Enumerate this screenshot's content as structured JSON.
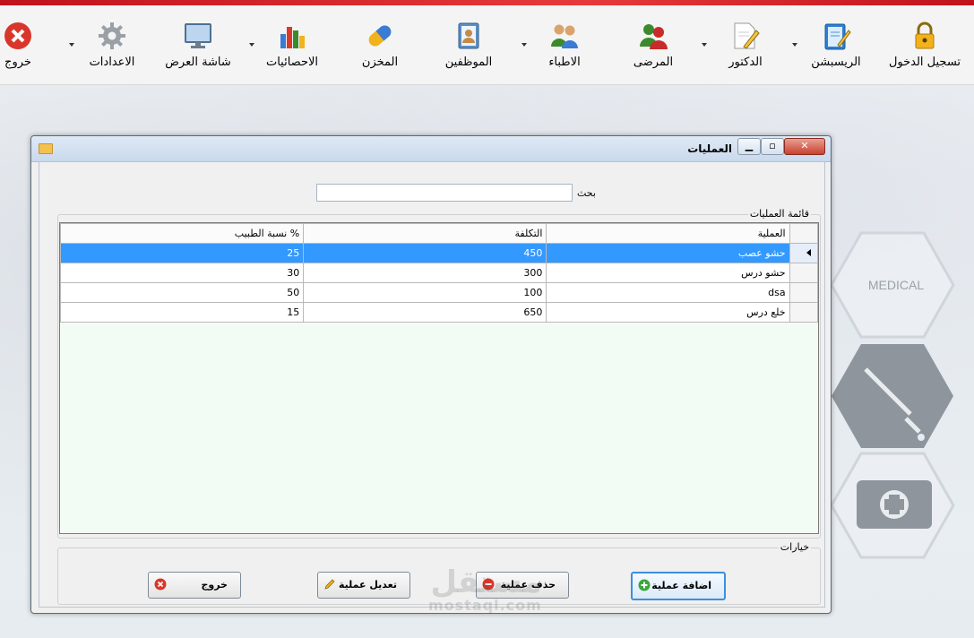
{
  "toolbar": {
    "items": [
      {
        "label": "تسجيل الدخول",
        "icon": "lock-icon"
      },
      {
        "label": "الريسبشن",
        "icon": "notebook-icon"
      },
      {
        "label": "الدكتور",
        "icon": "pencil-paper-icon"
      },
      {
        "label": "المرضى",
        "icon": "patients-icon"
      },
      {
        "label": "الاطباء",
        "icon": "doctors-icon"
      },
      {
        "label": "الموظفين",
        "icon": "address-book-icon"
      },
      {
        "label": "المخزن",
        "icon": "pill-icon"
      },
      {
        "label": "الاحصائيات",
        "icon": "bar-chart-icon"
      },
      {
        "label": "شاشة العرض",
        "icon": "monitor-icon"
      },
      {
        "label": "الاعدادات",
        "icon": "gear-icon"
      },
      {
        "label": "خروج",
        "icon": "close-circle-icon"
      }
    ]
  },
  "background": {
    "medical_text": "MEDICAL"
  },
  "window": {
    "title": "العمليات",
    "search_label": "بحث",
    "search_value": "",
    "list_group_title": "قائمة العمليات",
    "options_group_title": "خيارات",
    "columns": [
      "العملية",
      "التكلفة",
      "نسبة الطبيب  %"
    ],
    "rows": [
      {
        "operation": "حشو عصب",
        "cost": "450",
        "doctor_pct": "25",
        "selected": true
      },
      {
        "operation": "حشو درس",
        "cost": "300",
        "doctor_pct": "30",
        "selected": false
      },
      {
        "operation": "dsa",
        "cost": "100",
        "doctor_pct": "50",
        "selected": false
      },
      {
        "operation": "خلع درس",
        "cost": "650",
        "doctor_pct": "15",
        "selected": false
      }
    ],
    "buttons": {
      "add": "اضافة عملية",
      "delete": "حذف عملية",
      "edit": "تعديل عملية",
      "exit": "خروج"
    }
  },
  "watermark": {
    "arabic": "مستقل",
    "latin": "mostaql.com"
  },
  "colors": {
    "selection": "#3399ff",
    "grid_background": "#f3fbf5",
    "top_strip": "#c0121b"
  }
}
